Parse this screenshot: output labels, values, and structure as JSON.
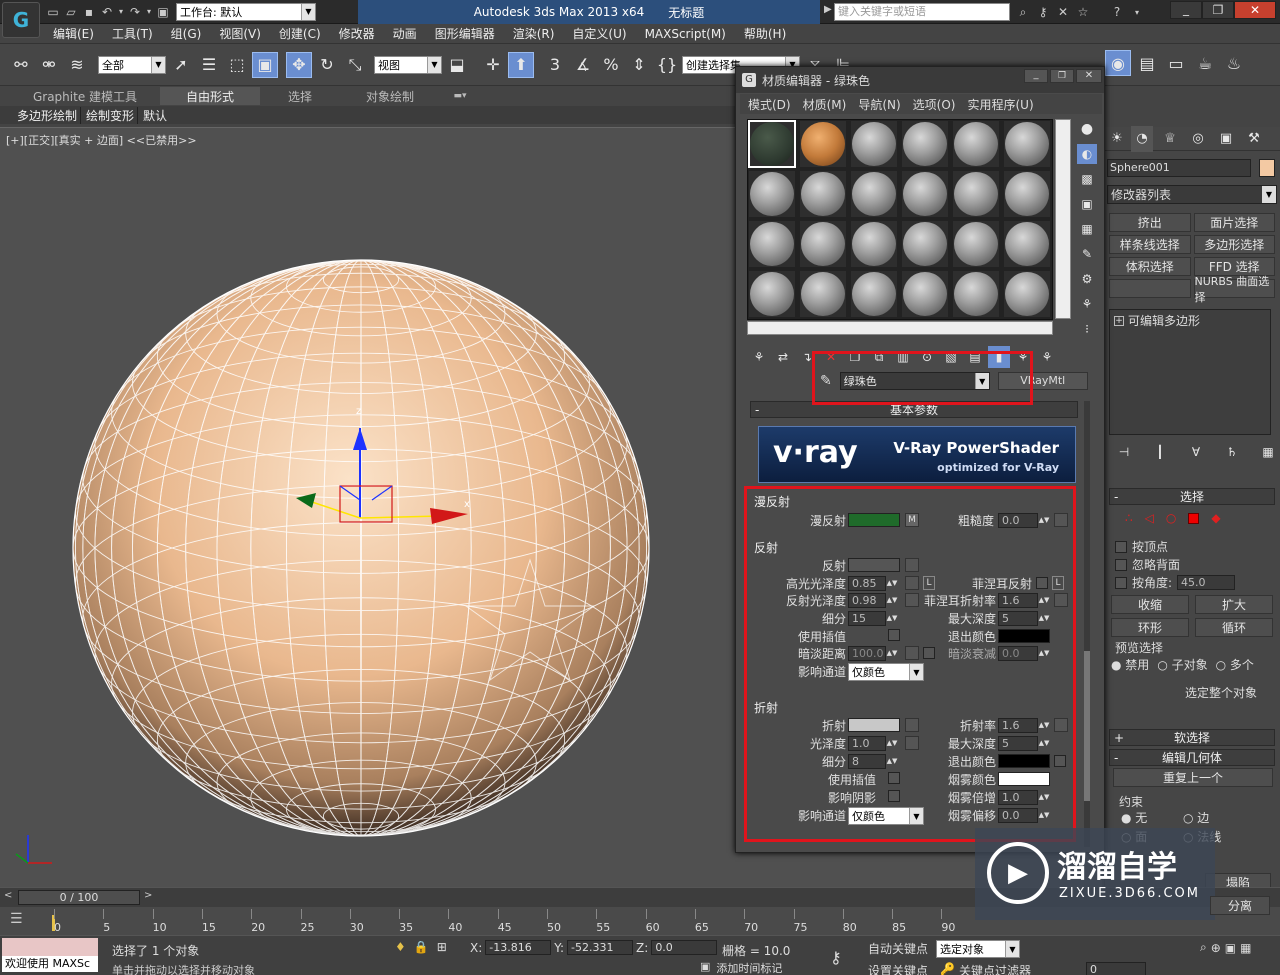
{
  "title_bar": {
    "workspace_label": "工作台: 默认",
    "app_title": "Autodesk 3ds Max  2013 x64",
    "doc_title": "无标题",
    "search_placeholder": "键入关键字或短语"
  },
  "menu": [
    "编辑(E)",
    "工具(T)",
    "组(G)",
    "视图(V)",
    "创建(C)",
    "修改器",
    "动画",
    "图形编辑器",
    "渲染(R)",
    "自定义(U)",
    "MAXScript(M)",
    "帮助(H)"
  ],
  "toolbar": {
    "filter_value": "全部",
    "refcoord_value": "视图",
    "snap_labels": [
      "3",
      "%"
    ],
    "selection_set_value": "创建选择集"
  },
  "ribbon": {
    "tabs": [
      "Graphite 建模工具",
      "自由形式",
      "选择",
      "对象绘制"
    ],
    "subtabs": [
      "多边形绘制",
      "绘制变形",
      "默认"
    ]
  },
  "viewport": {
    "label": "[+][正交][真实 + 边面] <<已禁用>>",
    "axis_z": "z",
    "axis_x": "x"
  },
  "material_editor": {
    "title": "材质编辑器 - 绿珠色",
    "menu": [
      "模式(D)",
      "材质(M)",
      "导航(N)",
      "选项(O)",
      "实用程序(U)"
    ],
    "material_name": "绿珠色",
    "material_type": "VRayMtl",
    "rollout_title": "基本参数",
    "vray_banner": {
      "logo": "v·ray",
      "title": "V-Ray PowerShader",
      "subtitle": "optimized for V-Ray"
    },
    "diffuse": {
      "section": "漫反射",
      "label": "漫反射",
      "map_btn": "M",
      "roughness_label": "粗糙度",
      "roughness": "0.0",
      "color": "#1f6b2a"
    },
    "reflection": {
      "section": "反射",
      "reflect_label": "反射",
      "hilight_label": "高光光泽度",
      "hilight": "0.85",
      "l_btn": "L",
      "fresnel_label": "菲涅耳反射",
      "refl_gloss_label": "反射光泽度",
      "refl_gloss": "0.98",
      "fresnel_ior_label": "菲涅耳折射率",
      "fresnel_ior": "1.6",
      "subdivs_label": "细分",
      "subdivs": "15",
      "max_depth_label": "最大深度",
      "max_depth": "5",
      "interp_label": "使用插值",
      "exit_color_label": "退出颜色",
      "dim_dist_label": "暗淡距离",
      "dim_dist": "100.0",
      "dim_falloff_label": "暗淡衰减",
      "dim_falloff": "0.0",
      "channel_label": "影响通道",
      "channel_value": "仅颜色"
    },
    "refraction": {
      "section": "折射",
      "refract_label": "折射",
      "ior_label": "折射率",
      "ior": "1.6",
      "gloss_label": "光泽度",
      "gloss": "1.0",
      "max_depth_label": "最大深度",
      "max_depth": "5",
      "subdivs_label": "细分",
      "subdivs": "8",
      "exit_color_label": "退出颜色",
      "interp_label": "使用插值",
      "fog_color_label": "烟雾颜色",
      "shadows_label": "影响阴影",
      "fog_mult_label": "烟雾倍增",
      "fog_mult": "1.0",
      "channel_label": "影响通道",
      "channel_value": "仅颜色",
      "fog_bias_label": "烟雾偏移",
      "fog_bias": "0.0"
    }
  },
  "command_panel": {
    "object_name": "Sphere001",
    "modifier_list": "修改器列表",
    "buttons": [
      "挤出",
      "面片选择",
      "样条线选择",
      "多边形选择",
      "体积选择",
      "FFD 选择",
      "",
      "NURBS 曲面选择"
    ],
    "stack_item": "可编辑多边形",
    "selection_title": "选择",
    "by_vertex": "按顶点",
    "ignore_backface": "忽略背面",
    "by_angle": "按角度:",
    "angle_value": "45.0",
    "shrink": "收缩",
    "grow": "扩大",
    "ring": "环形",
    "loop": "循环",
    "preview_title": "预览选择",
    "preview_opts": [
      "禁用",
      "子对象",
      "多个"
    ],
    "select_whole": "选定整个对象",
    "soft_sel": "软选择",
    "edit_geo": "编辑几何体",
    "repeat_last": "重复上一个",
    "constraints": "约束",
    "constraint_opts": [
      "无",
      "边",
      "面",
      "法线"
    ],
    "collapse": "塌陷",
    "separate": "分离"
  },
  "timeline": {
    "frame_counter": "0 / 100",
    "ticks": [
      "0",
      "5",
      "10",
      "15",
      "20",
      "25",
      "30",
      "35",
      "40",
      "45",
      "50",
      "55",
      "60",
      "65",
      "70",
      "75",
      "80",
      "85",
      "90"
    ]
  },
  "status": {
    "welcome": "欢迎使用 MAXSc",
    "selected_text": "选择了 1 个对象",
    "prompt": "单击并拖动以选择并移动对象",
    "x_label": "X:",
    "x_value": "-13.816",
    "y_label": "Y:",
    "y_value": "-52.331",
    "z_label": "Z:",
    "z_value": "0.0",
    "grid": "栅格 = 10.0",
    "auto_key": "自动关键点",
    "set_key": "设置关键点",
    "selected_obj": "选定对象",
    "add_time_tag": "添加时间标记",
    "key_filter": "关键点过滤器",
    "frame": "0"
  },
  "watermark": {
    "name": "溜溜自学",
    "url": "ZIXUE.3D66.COM"
  },
  "colors": {
    "highlight_red": "#e0141c",
    "diffuse_green": "#1f6b2a",
    "sphere_peach": "#f3c9a3"
  }
}
